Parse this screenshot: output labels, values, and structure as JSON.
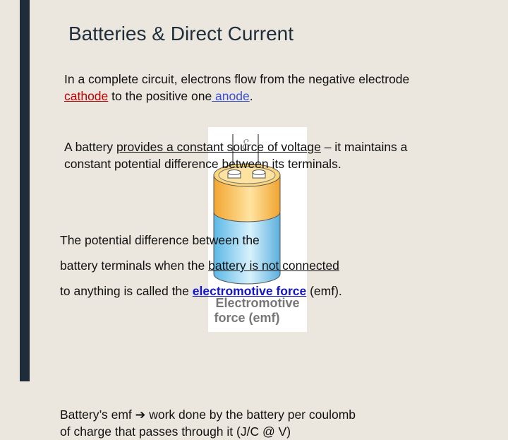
{
  "title": "Batteries & Direct Current",
  "p1": {
    "a": "In a complete circuit, electrons flow from the negative electrode",
    "cathode": "cathode",
    "b": " to the positive one",
    "anode": " anode",
    "c": "."
  },
  "p2": {
    "a": "A battery ",
    "u1": "provides a constant source of voltage",
    "b": " – it maintains a",
    "line2": "constant potential difference between its terminals."
  },
  "p3": {
    "line1": "The potential difference between the",
    "line2a": "battery terminals when the ",
    "line2u": "battery is not connected",
    "line3a": "to anything is called the ",
    "emf_link": "electromotive force",
    "line3b": " (emf)."
  },
  "p4": {
    "line1a": "Battery’s emf ",
    "arrow": "➔",
    "line1b": " work done by the battery per coulomb",
    "line2": "of charge that passes through it (J/C @ V)"
  },
  "figure": {
    "symbol": "ℰ",
    "caption1": "Electromotive",
    "caption2": "force (emf)"
  },
  "colors": {
    "accent_bar": "#1f2d3b",
    "cathode": "#c00000",
    "anode": "#3b4fd6",
    "link": "#1515c8",
    "battery_top": "#f7b84a",
    "battery_body": "#8fd0f0"
  }
}
